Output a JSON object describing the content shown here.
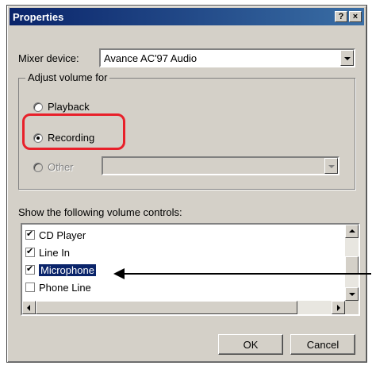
{
  "window": {
    "title": "Properties",
    "help_glyph": "?",
    "close_glyph": "×"
  },
  "mixer": {
    "label": "Mixer device:",
    "value": "Avance AC'97 Audio"
  },
  "adjust_group": {
    "legend": "Adjust volume for",
    "options": [
      {
        "label": "Playback",
        "checked": false,
        "enabled": true
      },
      {
        "label": "Recording",
        "checked": true,
        "enabled": true
      },
      {
        "label": "Other",
        "checked": false,
        "enabled": false
      }
    ],
    "other_value": ""
  },
  "controls": {
    "label": "Show the following volume controls:",
    "items": [
      {
        "label": "CD Player",
        "checked": true,
        "selected": false
      },
      {
        "label": "Line In",
        "checked": true,
        "selected": false
      },
      {
        "label": "Microphone",
        "checked": true,
        "selected": true
      },
      {
        "label": "Phone Line",
        "checked": false,
        "selected": false
      }
    ]
  },
  "buttons": {
    "ok": "OK",
    "cancel": "Cancel"
  },
  "annotation": {
    "highlight_color": "#e8202a",
    "arrow_color": "#000000"
  },
  "colors": {
    "title_bar": "#0a246a",
    "dialog_bg": "#d4d0c8",
    "selection": "#0a246a"
  }
}
